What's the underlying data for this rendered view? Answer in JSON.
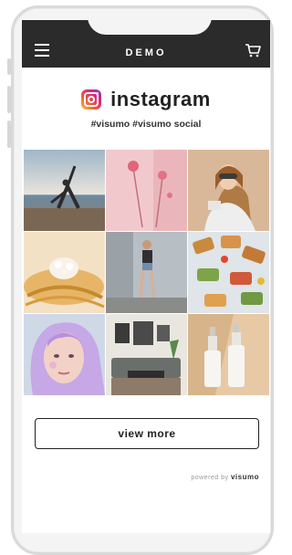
{
  "header": {
    "title": "DEMO",
    "menu_icon": "hamburger-menu-icon",
    "cart_icon": "shopping-cart-icon",
    "background": "#2b2b2b"
  },
  "brand": {
    "name": "instagram",
    "logo_icon": "instagram-logo-icon",
    "hashtags": "#visumo #visumo social"
  },
  "grid": {
    "photos": [
      {
        "name": "yoga-pose-beach"
      },
      {
        "name": "pink-flowers"
      },
      {
        "name": "woman-sunglasses"
      },
      {
        "name": "gold-jewelry"
      },
      {
        "name": "woman-street-wall"
      },
      {
        "name": "toast-snacks"
      },
      {
        "name": "purple-hair-portrait"
      },
      {
        "name": "living-room-interior"
      },
      {
        "name": "cosmetic-bottles"
      }
    ]
  },
  "actions": {
    "view_more_label": "view more"
  },
  "footer": {
    "powered_prefix": "powered by ",
    "powered_brand": "visumo"
  }
}
